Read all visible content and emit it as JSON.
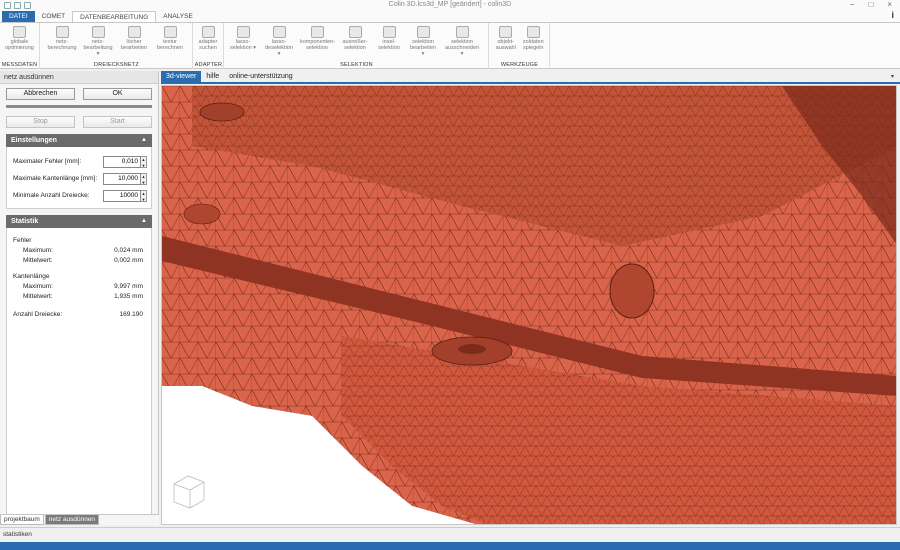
{
  "window": {
    "title": "Colin 3D.lcs3d_MP [geändert] - colin3D",
    "minimize": "−",
    "maximize": "□",
    "close": "×"
  },
  "ribbon_tabs": [
    {
      "label": "DATEI"
    },
    {
      "label": "COMET"
    },
    {
      "label": "DATENBEARBEITUNG"
    },
    {
      "label": "ANALYSE"
    }
  ],
  "help_label": "i",
  "ribbon_groups": {
    "messdaten": {
      "label": "MESSDATEN",
      "buttons": [
        {
          "line1": "globale",
          "line2": "optimierung"
        }
      ]
    },
    "dreiecksnetz": {
      "label": "DREIECKSNETZ",
      "buttons": [
        {
          "line1": "netz-",
          "line2": "berechnung"
        },
        {
          "line1": "netz-",
          "line2": "bearbeitung ▾"
        },
        {
          "line1": "löcher",
          "line2": "bearbeiten"
        },
        {
          "line1": "textur",
          "line2": "berechnen"
        }
      ]
    },
    "adapter": {
      "label": "ADAPTER",
      "buttons": [
        {
          "line1": "adapter",
          "line2": "suchen"
        }
      ]
    },
    "selektion": {
      "label": "SELEKTION",
      "buttons": [
        {
          "line1": "lasso-",
          "line2": "selektion ▾"
        },
        {
          "line1": "lasso-",
          "line2": "deselektion ▾"
        },
        {
          "line1": "komponenten-",
          "line2": "selektion"
        },
        {
          "line1": "ausreißer-",
          "line2": "selektion"
        },
        {
          "line1": "insel-",
          "line2": "selektion"
        },
        {
          "line1": "selektion",
          "line2": "bearbeiten ▾"
        },
        {
          "line1": "selektion",
          "line2": "ausschneiden ▾"
        }
      ]
    },
    "werkzeuge": {
      "label": "WERKZEUGE",
      "buttons": [
        {
          "line1": "objekt-",
          "line2": "auswahl"
        },
        {
          "line1": "zoldaten",
          "line2": "spiegeln"
        }
      ]
    }
  },
  "left_panel": {
    "title": "netz ausdünnen",
    "cancel_label": "Abbrechen",
    "ok_label": "OK",
    "stop_label": "Stop",
    "start_label": "Start",
    "settings": {
      "header": "Einstellungen",
      "max_error_label": "Maximaler Fehler [mm]:",
      "max_error_value": "0,010",
      "max_edge_label": "Maximale Kantenlänge [mm]:",
      "max_edge_value": "10,000",
      "min_triangles_label": "Minimale Anzahl Dreiecke:",
      "min_triangles_value": "10000"
    },
    "statistics": {
      "header": "Statistik",
      "error_label": "Fehler",
      "error_max_label": "Maximum:",
      "error_max_value": "0,024 mm",
      "error_mean_label": "Mittelwert:",
      "error_mean_value": "0,002 mm",
      "edge_label": "Kantenlänge",
      "edge_max_label": "Maximum:",
      "edge_max_value": "9,997 mm",
      "edge_mean_label": "Mittelwert:",
      "edge_mean_value": "1,935 mm",
      "triangles_label": "Anzahl Dreiecke:",
      "triangles_value": "169.190"
    }
  },
  "bottom_tabs": [
    {
      "label": "projektbaum"
    },
    {
      "label": "netz ausdünnen"
    }
  ],
  "viewer_tabs": [
    {
      "label": "3d-viewer"
    },
    {
      "label": "hilfe"
    },
    {
      "label": "online-unterstützung"
    }
  ],
  "viewer_dropdown": "▾",
  "status_label": "statistiken",
  "colors": {
    "mesh": "#d9644a",
    "mesh_dark": "#8f3322",
    "accent": "#2b6cb0"
  }
}
